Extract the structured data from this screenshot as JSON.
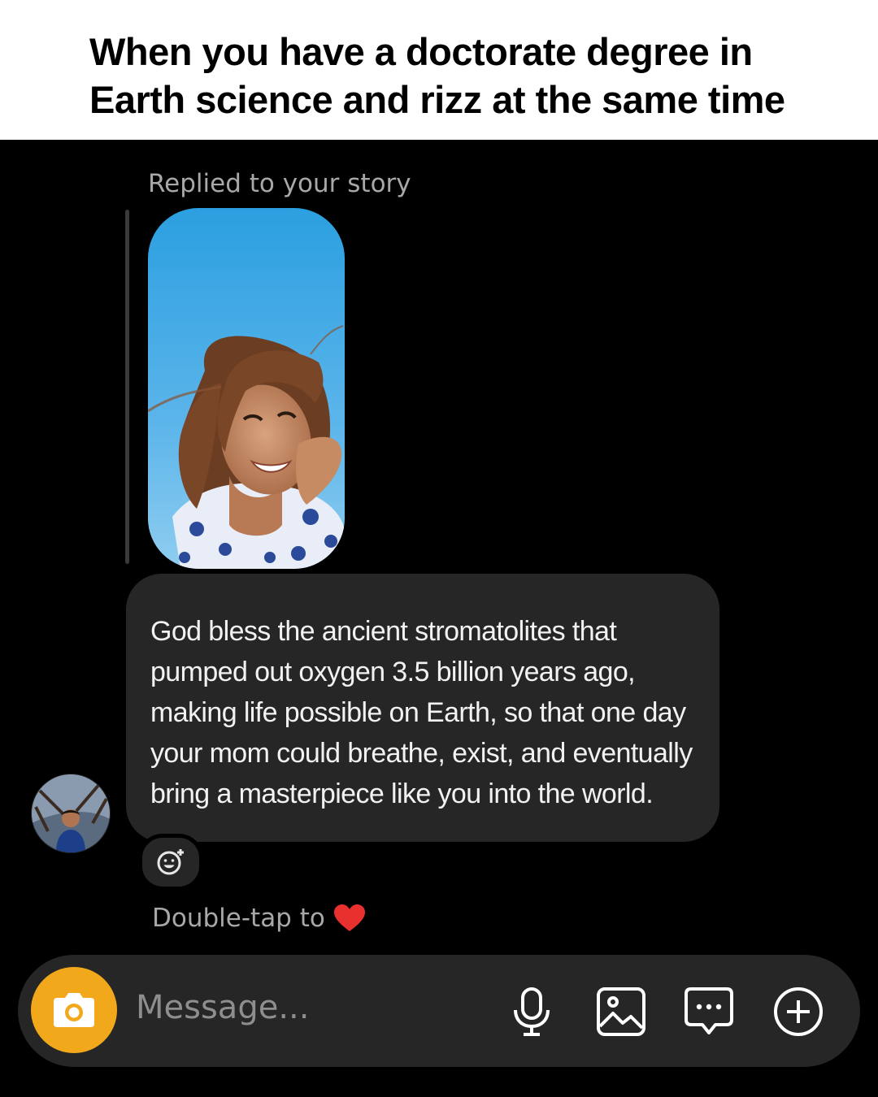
{
  "caption": {
    "line1": "When you have a doctorate degree in",
    "line2": "Earth science and rizz at the same time"
  },
  "story_reply": {
    "label": "Replied to your story"
  },
  "message": {
    "lines": [
      "God bless the ancient stromatolites that",
      "pumped out oxygen 3.5 billion years ago,",
      "making life possible on Earth, so that one day",
      "your mom could breathe, exist, and eventually",
      "bring a masterpiece like you into the world."
    ]
  },
  "hint": {
    "text": "Double-tap to"
  },
  "composer": {
    "placeholder": "Message..."
  },
  "colors": {
    "background": "#000000",
    "bubble": "#262626",
    "camera_button": "#f2a81b",
    "heart": "#e8302f",
    "muted_text": "#a8a8a8"
  },
  "icons": {
    "composer": [
      "camera-icon",
      "microphone-icon",
      "gallery-icon",
      "sticker-chat-icon",
      "plus-circle-icon"
    ],
    "reaction": "emoji-add-icon",
    "hint": "heart-icon"
  }
}
